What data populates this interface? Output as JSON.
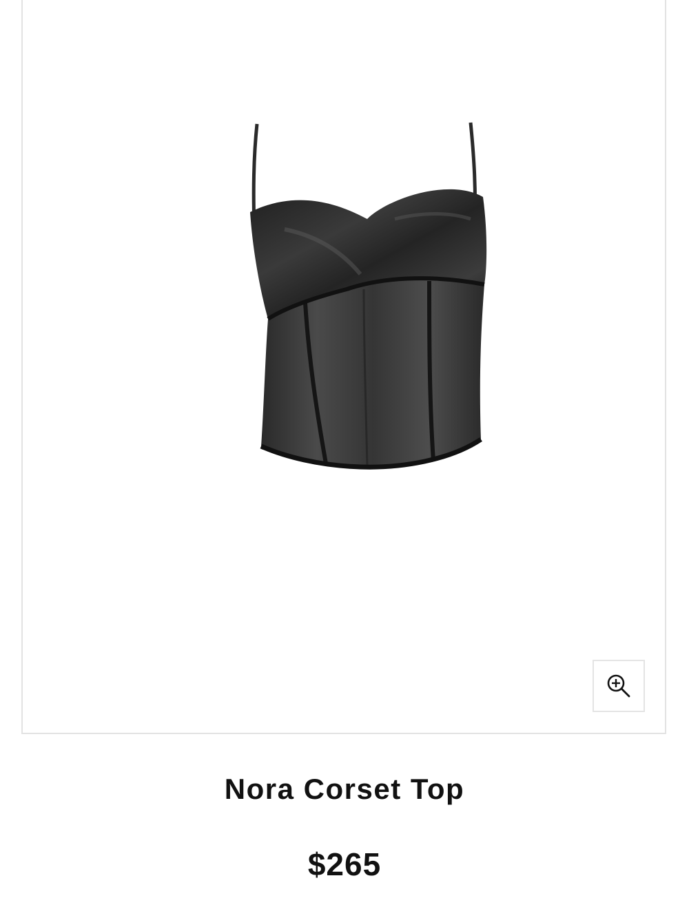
{
  "product": {
    "title": "Nora Corset Top",
    "price": "$265",
    "image_icon": "corset-top-image"
  },
  "gallery": {
    "zoom_icon": "zoom-in-icon"
  },
  "colors": {
    "garment": "#2b2b2b",
    "text": "#111111",
    "border": "#e2e2e2"
  }
}
